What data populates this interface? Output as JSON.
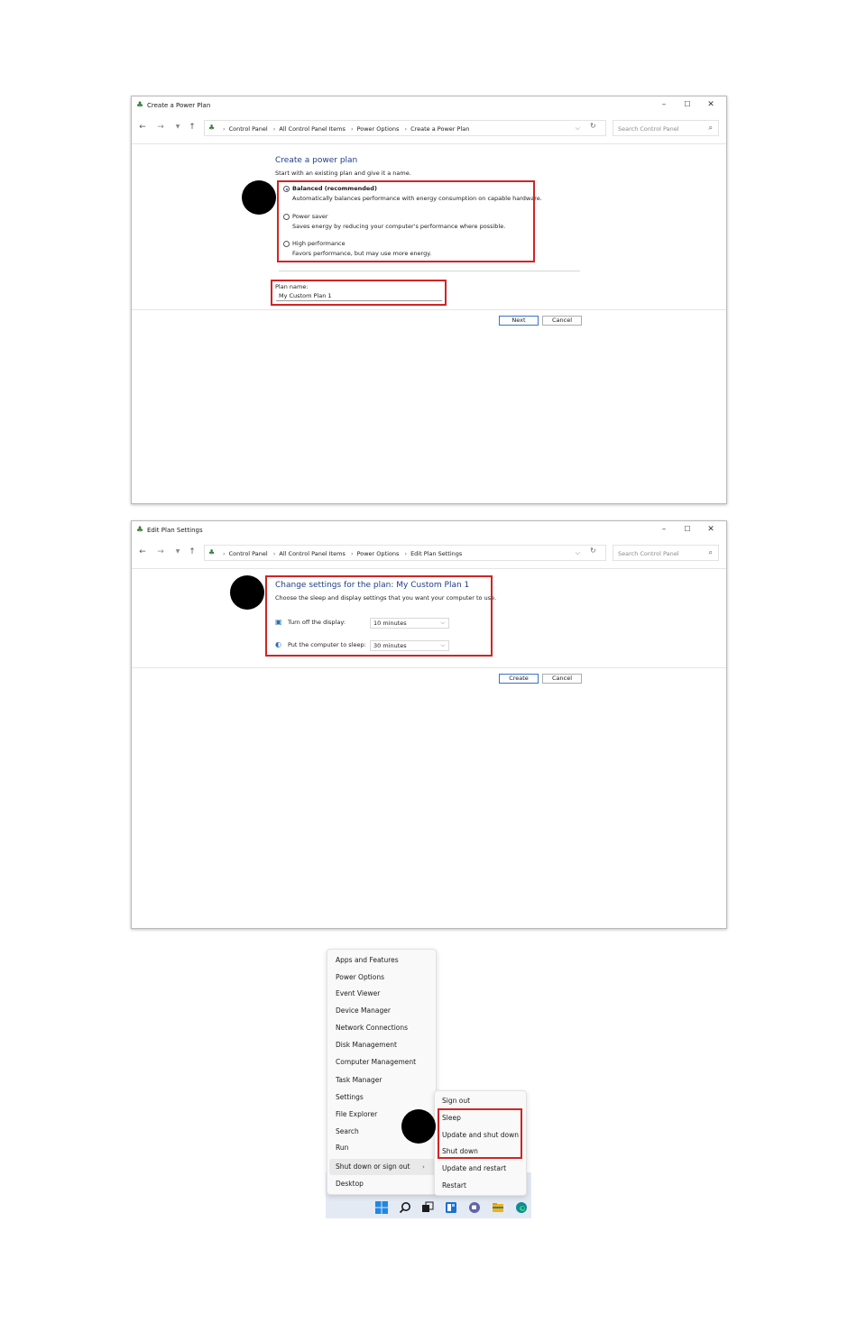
{
  "window1": {
    "title": "Create a Power Plan",
    "breadcrumbs": [
      "Control Panel",
      "All Control Panel Items",
      "Power Options",
      "Create a Power Plan"
    ],
    "search_placeholder": "Search Control Panel",
    "heading": "Create a power plan",
    "subheading": "Start with an existing plan and give it a name.",
    "options": [
      {
        "title": "Balanced (recommended)",
        "desc": "Automatically balances performance with energy consumption on capable hardware.",
        "selected": true
      },
      {
        "title": "Power saver",
        "desc": "Saves energy by reducing your computer's performance where possible.",
        "selected": false
      },
      {
        "title": "High performance",
        "desc": "Favors performance, but may use more energy.",
        "selected": false
      }
    ],
    "plan_name_label": "Plan name:",
    "plan_name_value": "My Custom Plan 1",
    "next_label": "Next",
    "cancel_label": "Cancel"
  },
  "window2": {
    "title": "Edit Plan Settings",
    "breadcrumbs": [
      "Control Panel",
      "All Control Panel Items",
      "Power Options",
      "Edit Plan Settings"
    ],
    "search_placeholder": "Search Control Panel",
    "heading": "Change settings for the plan: My Custom Plan 1",
    "subheading": "Choose the sleep and display settings that you want your computer to use.",
    "display_label": "Turn off the display:",
    "display_value": "10 minutes",
    "sleep_label": "Put the computer to sleep:",
    "sleep_value": "30 minutes",
    "create_label": "Create",
    "cancel_label": "Cancel"
  },
  "context_menu": {
    "items": [
      "Apps and Features",
      "Power Options",
      "Event Viewer",
      "Device Manager",
      "Network Connections",
      "Disk Management",
      "Computer Management",
      "Task Manager",
      "Settings",
      "File Explorer",
      "Search",
      "Run",
      "Shut down or sign out",
      "Desktop"
    ],
    "submenu": [
      "Sign out",
      "Sleep",
      "Update and shut down",
      "Shut down",
      "Update and restart",
      "Restart"
    ]
  },
  "colors": {
    "highlight_box": "#d22424",
    "heading_blue": "#1f3f87",
    "callout": "#000000"
  }
}
